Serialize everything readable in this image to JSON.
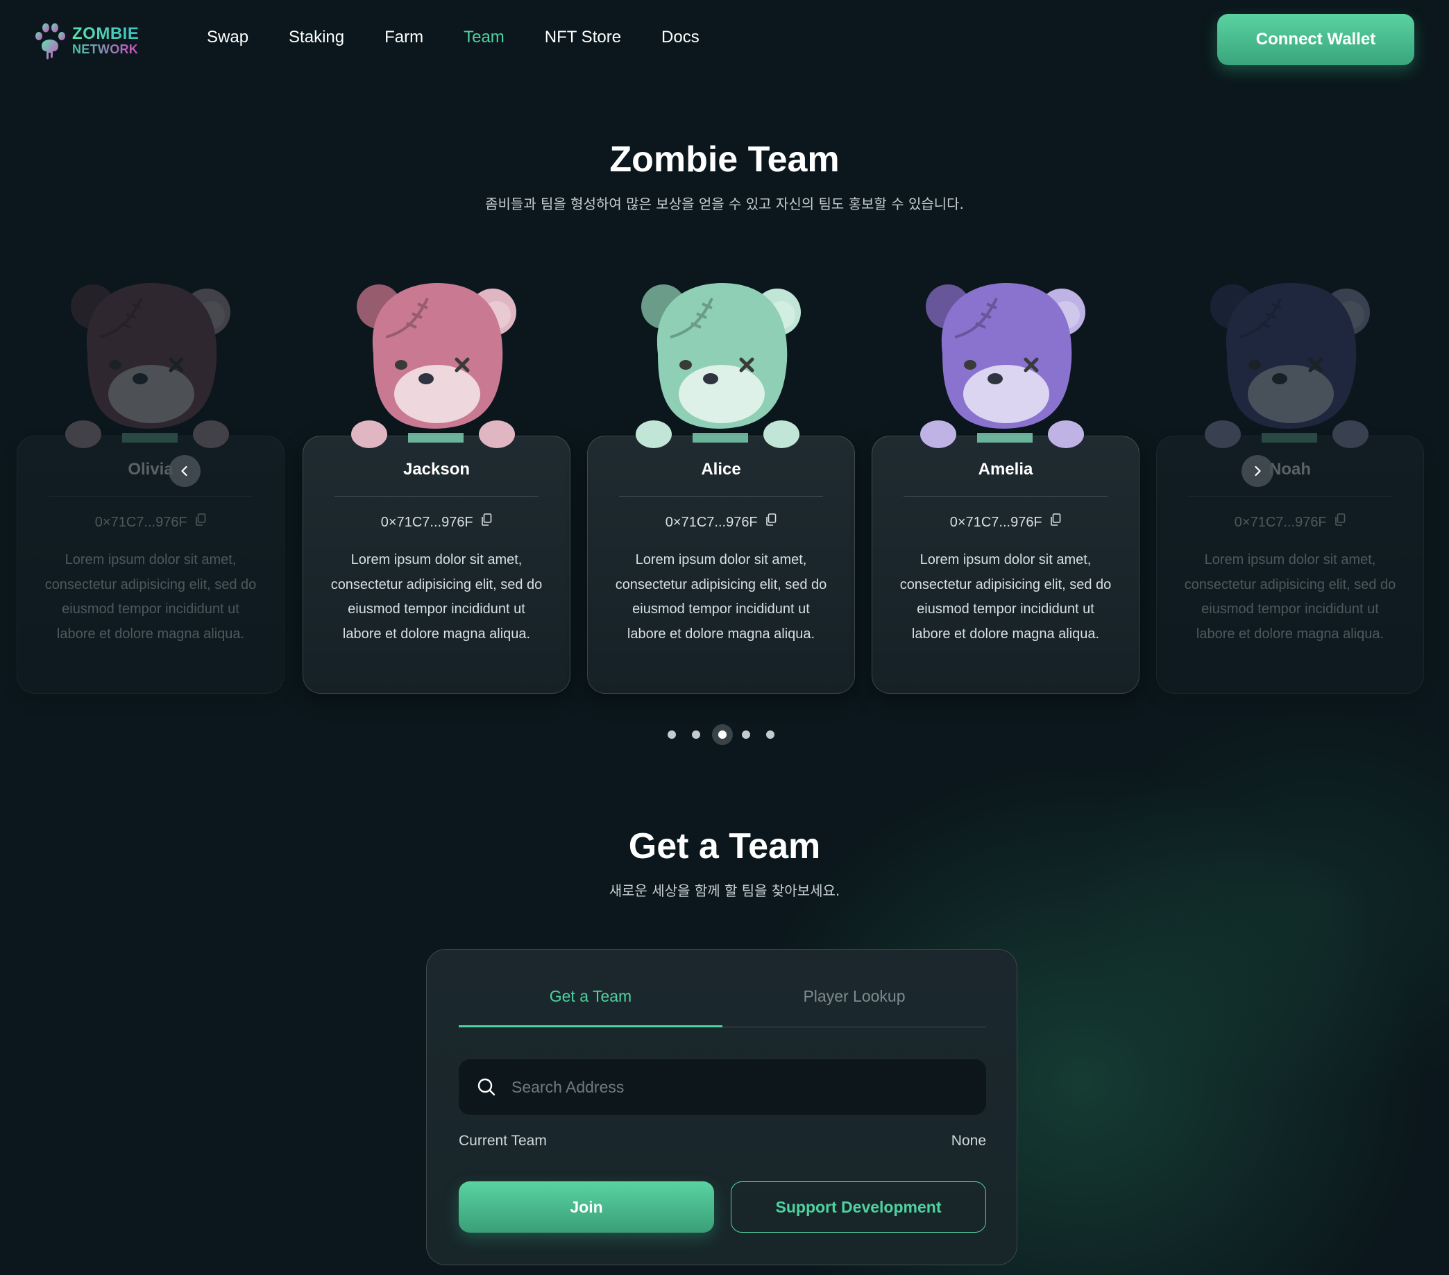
{
  "brand": {
    "line1": "ZOMBIE",
    "line2": "NETWORK"
  },
  "nav": {
    "items": [
      {
        "label": "Swap",
        "active": false
      },
      {
        "label": "Staking",
        "active": false
      },
      {
        "label": "Farm",
        "active": false
      },
      {
        "label": "Team",
        "active": true
      },
      {
        "label": "NFT Store",
        "active": false
      },
      {
        "label": "Docs",
        "active": false
      }
    ],
    "connect_label": "Connect Wallet"
  },
  "team_section": {
    "title": "Zombie Team",
    "subtitle": "좀비들과 팀을 형성하여 많은 보상을 얻을 수 있고 자신의 팀도 홍보할 수 있습니다.",
    "members": [
      {
        "name": "Olivia",
        "address": "0×71C7...976F",
        "description": "Lorem ipsum dolor sit amet, consectetur adipisicing elit, sed do eiusmod tempor incididunt ut labore et dolore magna aliqua.",
        "color": "#7a4a5a",
        "faded": true
      },
      {
        "name": "Jackson",
        "address": "0×71C7...976F",
        "description": "Lorem ipsum dolor sit amet, consectetur adipisicing elit, sed do eiusmod tempor incididunt ut labore et dolore magna aliqua.",
        "color": "#c97a92",
        "faded": false
      },
      {
        "name": "Alice",
        "address": "0×71C7...976F",
        "description": "Lorem ipsum dolor sit amet, consectetur adipisicing elit, sed do eiusmod tempor incididunt ut labore et dolore magna aliqua.",
        "color": "#8ecfb6",
        "faded": false
      },
      {
        "name": "Amelia",
        "address": "0×71C7...976F",
        "description": "Lorem ipsum dolor sit amet, consectetur adipisicing elit, sed do eiusmod tempor incididunt ut labore et dolore magna aliqua.",
        "color": "#8a73cf",
        "faded": false
      },
      {
        "name": "Noah",
        "address": "0×71C7...976F",
        "description": "Lorem ipsum dolor sit amet, consectetur adipisicing elit, sed do eiusmod tempor incididunt ut labore et dolore magna aliqua.",
        "color": "#4a4a8a",
        "faded": true
      }
    ],
    "pagination": {
      "count": 5,
      "active": 3
    },
    "icons": {
      "prev": "chevron-left-icon",
      "next": "chevron-right-icon",
      "copy": "copy-icon"
    }
  },
  "get_team_section": {
    "title": "Get a Team",
    "subtitle": "새로운 세상을 함께 할 팀을 찾아보세요.",
    "tabs": [
      {
        "label": "Get a Team",
        "active": true
      },
      {
        "label": "Player Lookup",
        "active": false
      }
    ],
    "search": {
      "placeholder": "Search Address",
      "value": ""
    },
    "current_team": {
      "label": "Current Team",
      "value": "None"
    },
    "join_label": "Join",
    "support_label": "Support Development"
  },
  "colors": {
    "accent": "#4fd3a0",
    "background": "#0b171c",
    "card": "#1b272c"
  }
}
